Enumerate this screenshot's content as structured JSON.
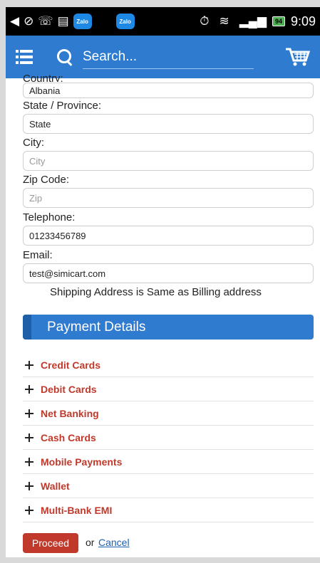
{
  "status_bar": {
    "battery": "94",
    "time": "9:09",
    "zalo_label": "Zalo"
  },
  "app_bar": {
    "search_placeholder": "Search..."
  },
  "form": {
    "country_label": "Country:",
    "country_value": "Albania",
    "state_label": "State / Province:",
    "state_value": "State",
    "city_label": "City:",
    "city_placeholder": "City",
    "zip_label": "Zip Code:",
    "zip_placeholder": "Zip",
    "telephone_label": "Telephone:",
    "telephone_value": "01233456789",
    "email_label": "Email:",
    "email_value": "test@simicart.com",
    "same_address_text": "Shipping Address is Same as Billing address"
  },
  "payment": {
    "header": "Payment Details",
    "options": [
      {
        "label": "Credit Cards"
      },
      {
        "label": "Debit Cards"
      },
      {
        "label": "Net Banking"
      },
      {
        "label": "Cash Cards"
      },
      {
        "label": "Mobile Payments"
      },
      {
        "label": "Wallet"
      },
      {
        "label": "Multi-Bank EMI"
      }
    ]
  },
  "actions": {
    "proceed_label": "Proceed",
    "or_text": "or",
    "cancel_label": "Cancel"
  },
  "colors": {
    "app_bar": "#2e7bd0",
    "accent_red": "#c0392b",
    "link_blue": "#1a5fb4"
  }
}
